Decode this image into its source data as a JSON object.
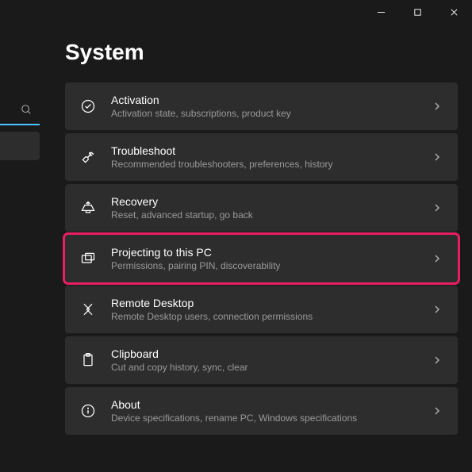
{
  "page_title": "System",
  "items": [
    {
      "title": "Activation",
      "desc": "Activation state, subscriptions, product key",
      "icon": "check-circle",
      "highlighted": false
    },
    {
      "title": "Troubleshoot",
      "desc": "Recommended troubleshooters, preferences, history",
      "icon": "wrench",
      "highlighted": false
    },
    {
      "title": "Recovery",
      "desc": "Reset, advanced startup, go back",
      "icon": "recovery",
      "highlighted": false
    },
    {
      "title": "Projecting to this PC",
      "desc": "Permissions, pairing PIN, discoverability",
      "icon": "project",
      "highlighted": true
    },
    {
      "title": "Remote Desktop",
      "desc": "Remote Desktop users, connection permissions",
      "icon": "remote",
      "highlighted": false
    },
    {
      "title": "Clipboard",
      "desc": "Cut and copy history, sync, clear",
      "icon": "clipboard",
      "highlighted": false
    },
    {
      "title": "About",
      "desc": "Device specifications, rename PC, Windows specifications",
      "icon": "info",
      "highlighted": false
    }
  ]
}
